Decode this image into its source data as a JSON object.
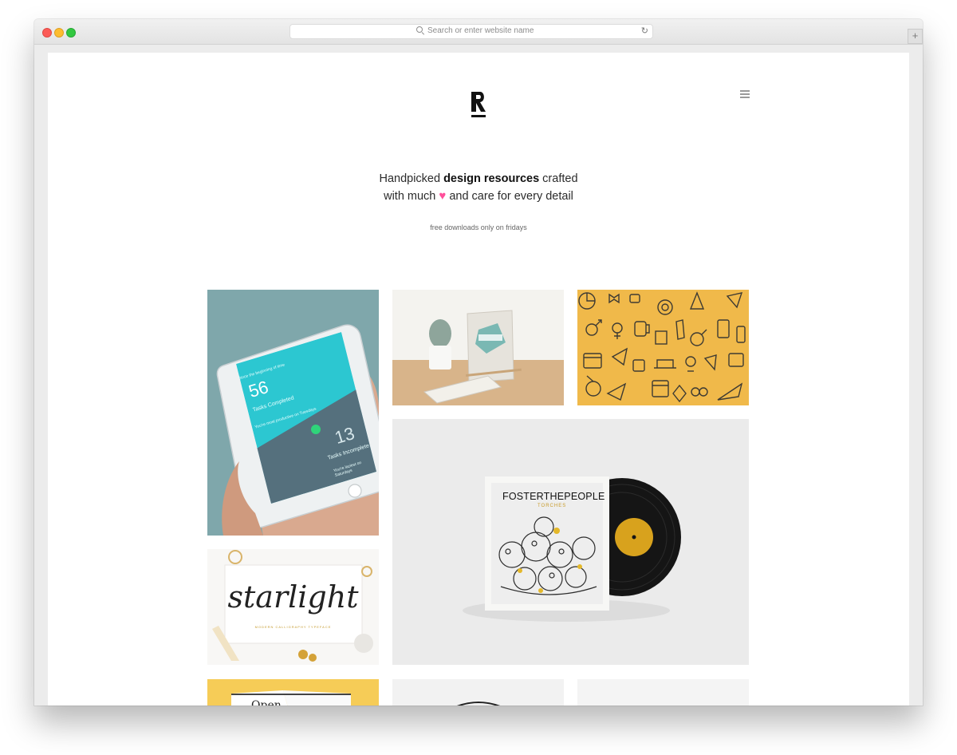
{
  "browser": {
    "address_placeholder": "Search or enter website name",
    "reload_icon": "reload-icon",
    "search_icon": "search-icon",
    "newtab_icon": "plus-icon",
    "newtab_glyph": "+"
  },
  "site": {
    "logo_letter": "R",
    "menu_icon": "hamburger-menu-icon",
    "tagline_pre": "Handpicked ",
    "tagline_bold": "design resources",
    "tagline_post": " crafted",
    "tagline_line2_pre": "with much ",
    "tagline_heart": "♥",
    "tagline_line2_post": " and care for every detail",
    "subline": "free downloads only on fridays",
    "accent_color": "#ff4f9a"
  },
  "tiles": {
    "app_mockup": {
      "header": "Since the beginning of time",
      "completed_count": "56",
      "completed_label": "Tasks Completed",
      "completed_note": "You're most productive on Tuesdays",
      "incomplete_count": "13",
      "incomplete_label": "Tasks Incomplete",
      "incomplete_note": "You're laziest on Saturdays"
    },
    "vinyl": {
      "title_bold": "FOSTER",
      "title_mid": "THE",
      "title_end": "PEOPLE",
      "subtitle": "TORCHES"
    },
    "starlight": {
      "title": "starlight",
      "subtitle": "MODERN CALLIGRAPHY TYPEFACE"
    },
    "book": {
      "title": "Open"
    }
  }
}
